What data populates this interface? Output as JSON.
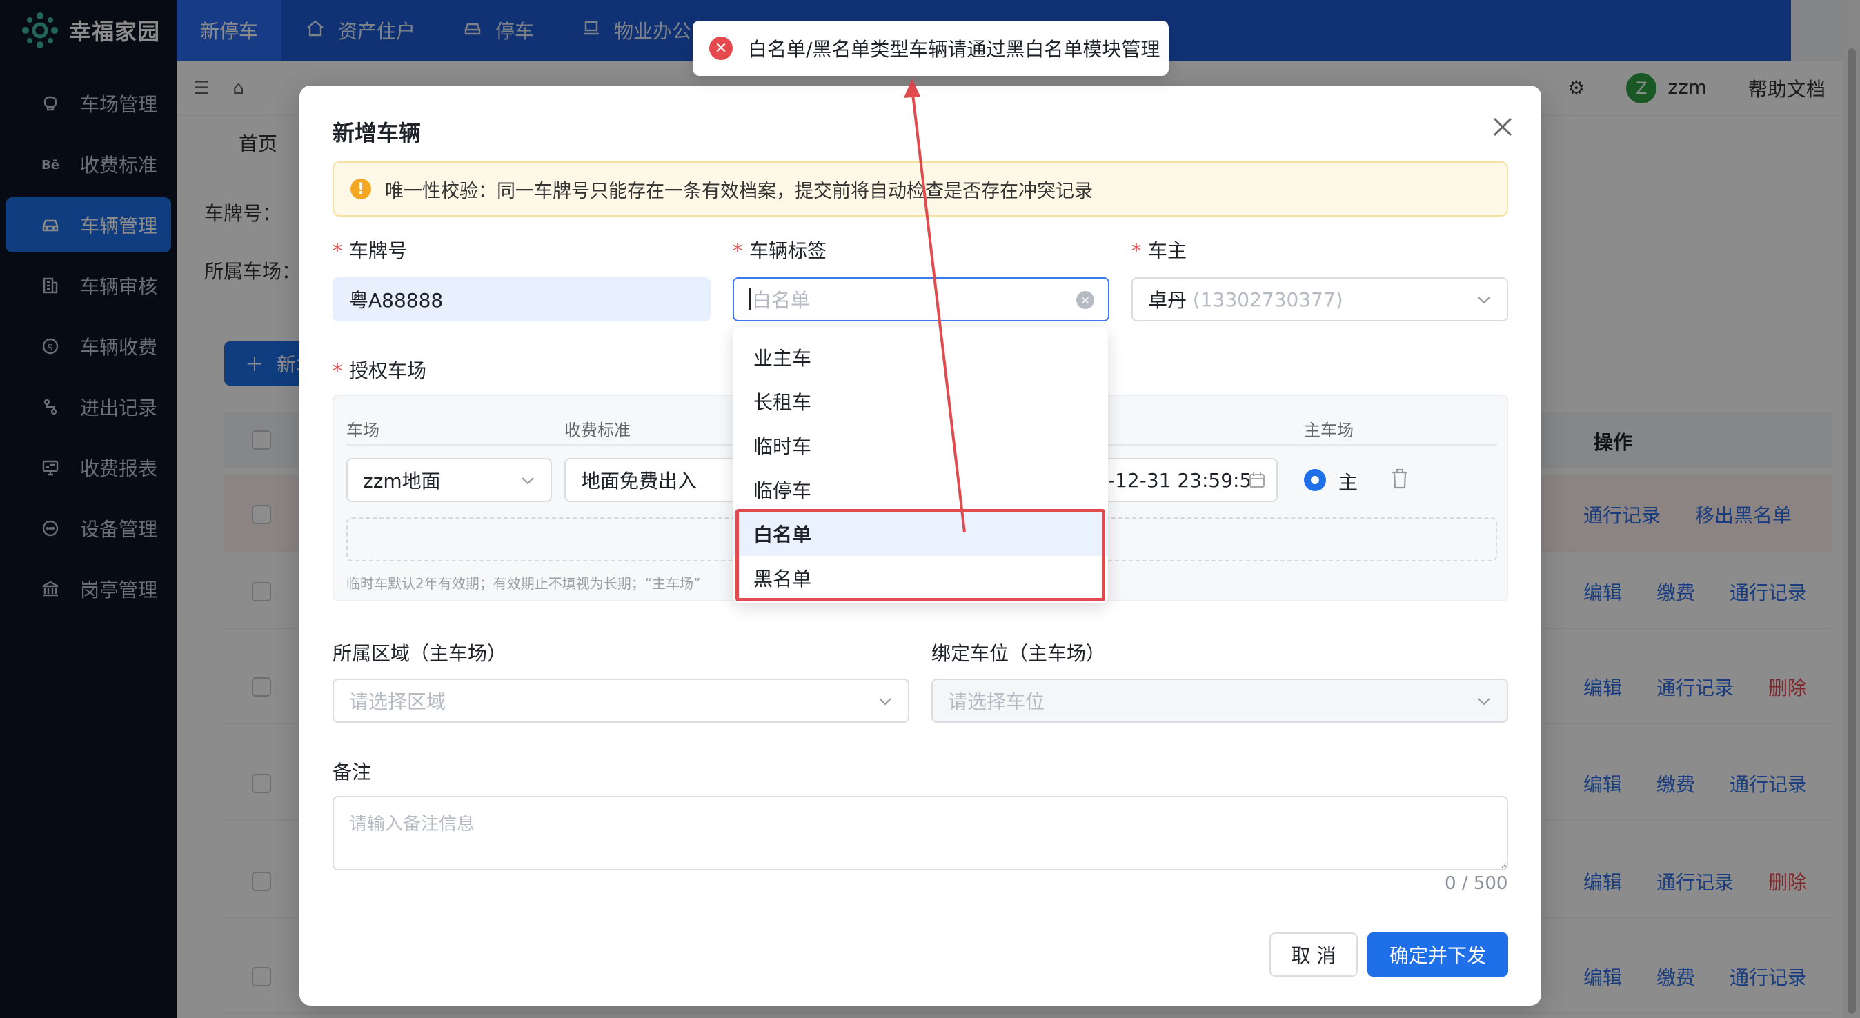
{
  "app": {
    "name": "幸福家园"
  },
  "topnav": {
    "tabs": [
      "新停车",
      "资产住户",
      "停车",
      "物业办公"
    ]
  },
  "sidebar": {
    "items": [
      {
        "label": "车场管理",
        "icon": "camera-icon"
      },
      {
        "label": "收费标准",
        "icon": "behance-icon"
      },
      {
        "label": "车辆管理",
        "icon": "car-icon",
        "active": true
      },
      {
        "label": "车辆审核",
        "icon": "building-icon"
      },
      {
        "label": "车辆收费",
        "icon": "dollar-icon"
      },
      {
        "label": "进出记录",
        "icon": "route-icon"
      },
      {
        "label": "收费报表",
        "icon": "monitor-icon"
      },
      {
        "label": "设备管理",
        "icon": "chat-icon"
      },
      {
        "label": "岗亭管理",
        "icon": "bank-icon"
      }
    ]
  },
  "header": {
    "user": "zzm",
    "user_initial": "Z",
    "help": "帮助文档"
  },
  "page": {
    "tab_home": "首页",
    "filter_plate": "车牌号：",
    "filter_lot": "所属车场：",
    "add_button": "新增",
    "ops_header": "操作",
    "rows": [
      {
        "ops": [
          "通行记录",
          "移出黑名单"
        ],
        "highlight": true
      },
      {
        "ops": [
          "编辑",
          "缴费",
          "通行记录"
        ]
      },
      {
        "ops": [
          "编辑",
          "通行记录",
          "删除"
        ]
      },
      {
        "ops": [
          "编辑",
          "缴费",
          "通行记录"
        ]
      },
      {
        "ops": [
          "编辑",
          "通行记录",
          "删除"
        ]
      },
      {
        "ops": [
          "编辑",
          "缴费",
          "通行记录"
        ]
      }
    ]
  },
  "modal": {
    "title": "新增车辆",
    "alert": "唯一性校验：同一车牌号只能存在一条有效档案，提交前将自动检查是否存在冲突记录",
    "plate_label": "车牌号",
    "plate_value": "粤A88888",
    "tag_label": "车辆标签",
    "tag_placeholder": "白名单",
    "owner_label": "车主",
    "owner_name": "卓丹",
    "owner_phone": "(13302730377)",
    "auth_label": "授权车场",
    "col_lot": "车场",
    "col_fee": "收费标准",
    "col_main": "主车场",
    "lot_value": "zzm地面",
    "fee_value": "地面免费出入",
    "date_value": "-12-31 23:59:5",
    "main_label": "主",
    "auth_hint": "临时车默认2年有效期；有效期止不填视为长期；“主车场”",
    "area_label": "所属区域（主车场）",
    "area_placeholder": "请选择区域",
    "space_label": "绑定车位（主车场）",
    "space_placeholder": "请选择车位",
    "remark_label": "备注",
    "remark_placeholder": "请输入备注信息",
    "remark_counter": "0 / 500",
    "cancel": "取 消",
    "confirm": "确定并下发"
  },
  "dropdown": {
    "options": [
      "业主车",
      "长租车",
      "临时车",
      "临停车",
      "白名单",
      "黑名单"
    ],
    "selected": "白名单"
  },
  "toast": {
    "message": "白名单/黑名单类型车辆请通过黑白名单模块管理",
    "type": "error"
  },
  "colors": {
    "primary": "#1e6fe8",
    "danger": "#e5484d",
    "sidebar": "#0b1526",
    "topnav": "#1e5bd6",
    "annotation": "#e04b50"
  }
}
